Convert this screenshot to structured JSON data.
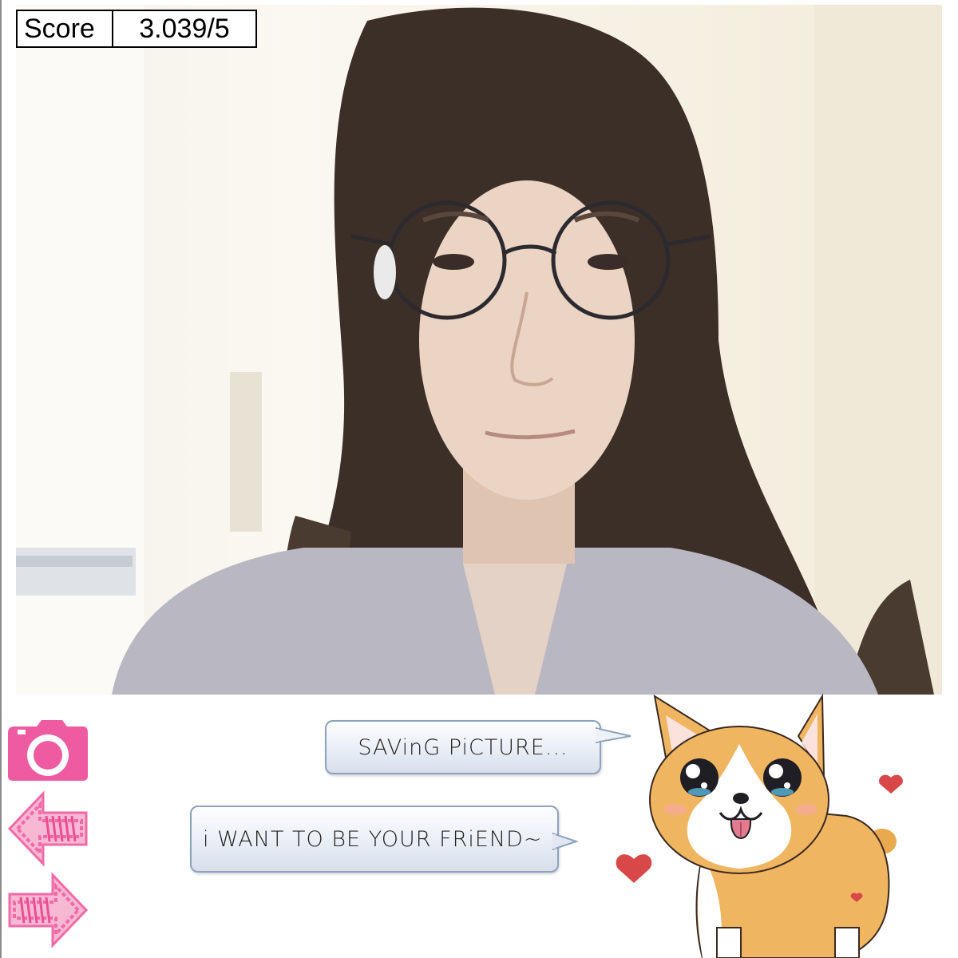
{
  "score": {
    "label": "Score",
    "value": "3.039/5"
  },
  "camera_feed": {
    "content": "selfie-portrait"
  },
  "controls": {
    "camera": {
      "icon": "camera-icon",
      "color": "#ef5ba1"
    },
    "back": {
      "icon": "arrow-left-icon",
      "color": "#f06aa6"
    },
    "forward": {
      "icon": "arrow-right-icon",
      "color": "#f06aa6"
    }
  },
  "messages": [
    {
      "text": "SAVinG PiCTURE..."
    },
    {
      "text": "i WANT TO BE YOUR FRiEND~"
    }
  ],
  "mascot": {
    "icon": "corgi-mascot",
    "heart_color": "#d94848"
  }
}
